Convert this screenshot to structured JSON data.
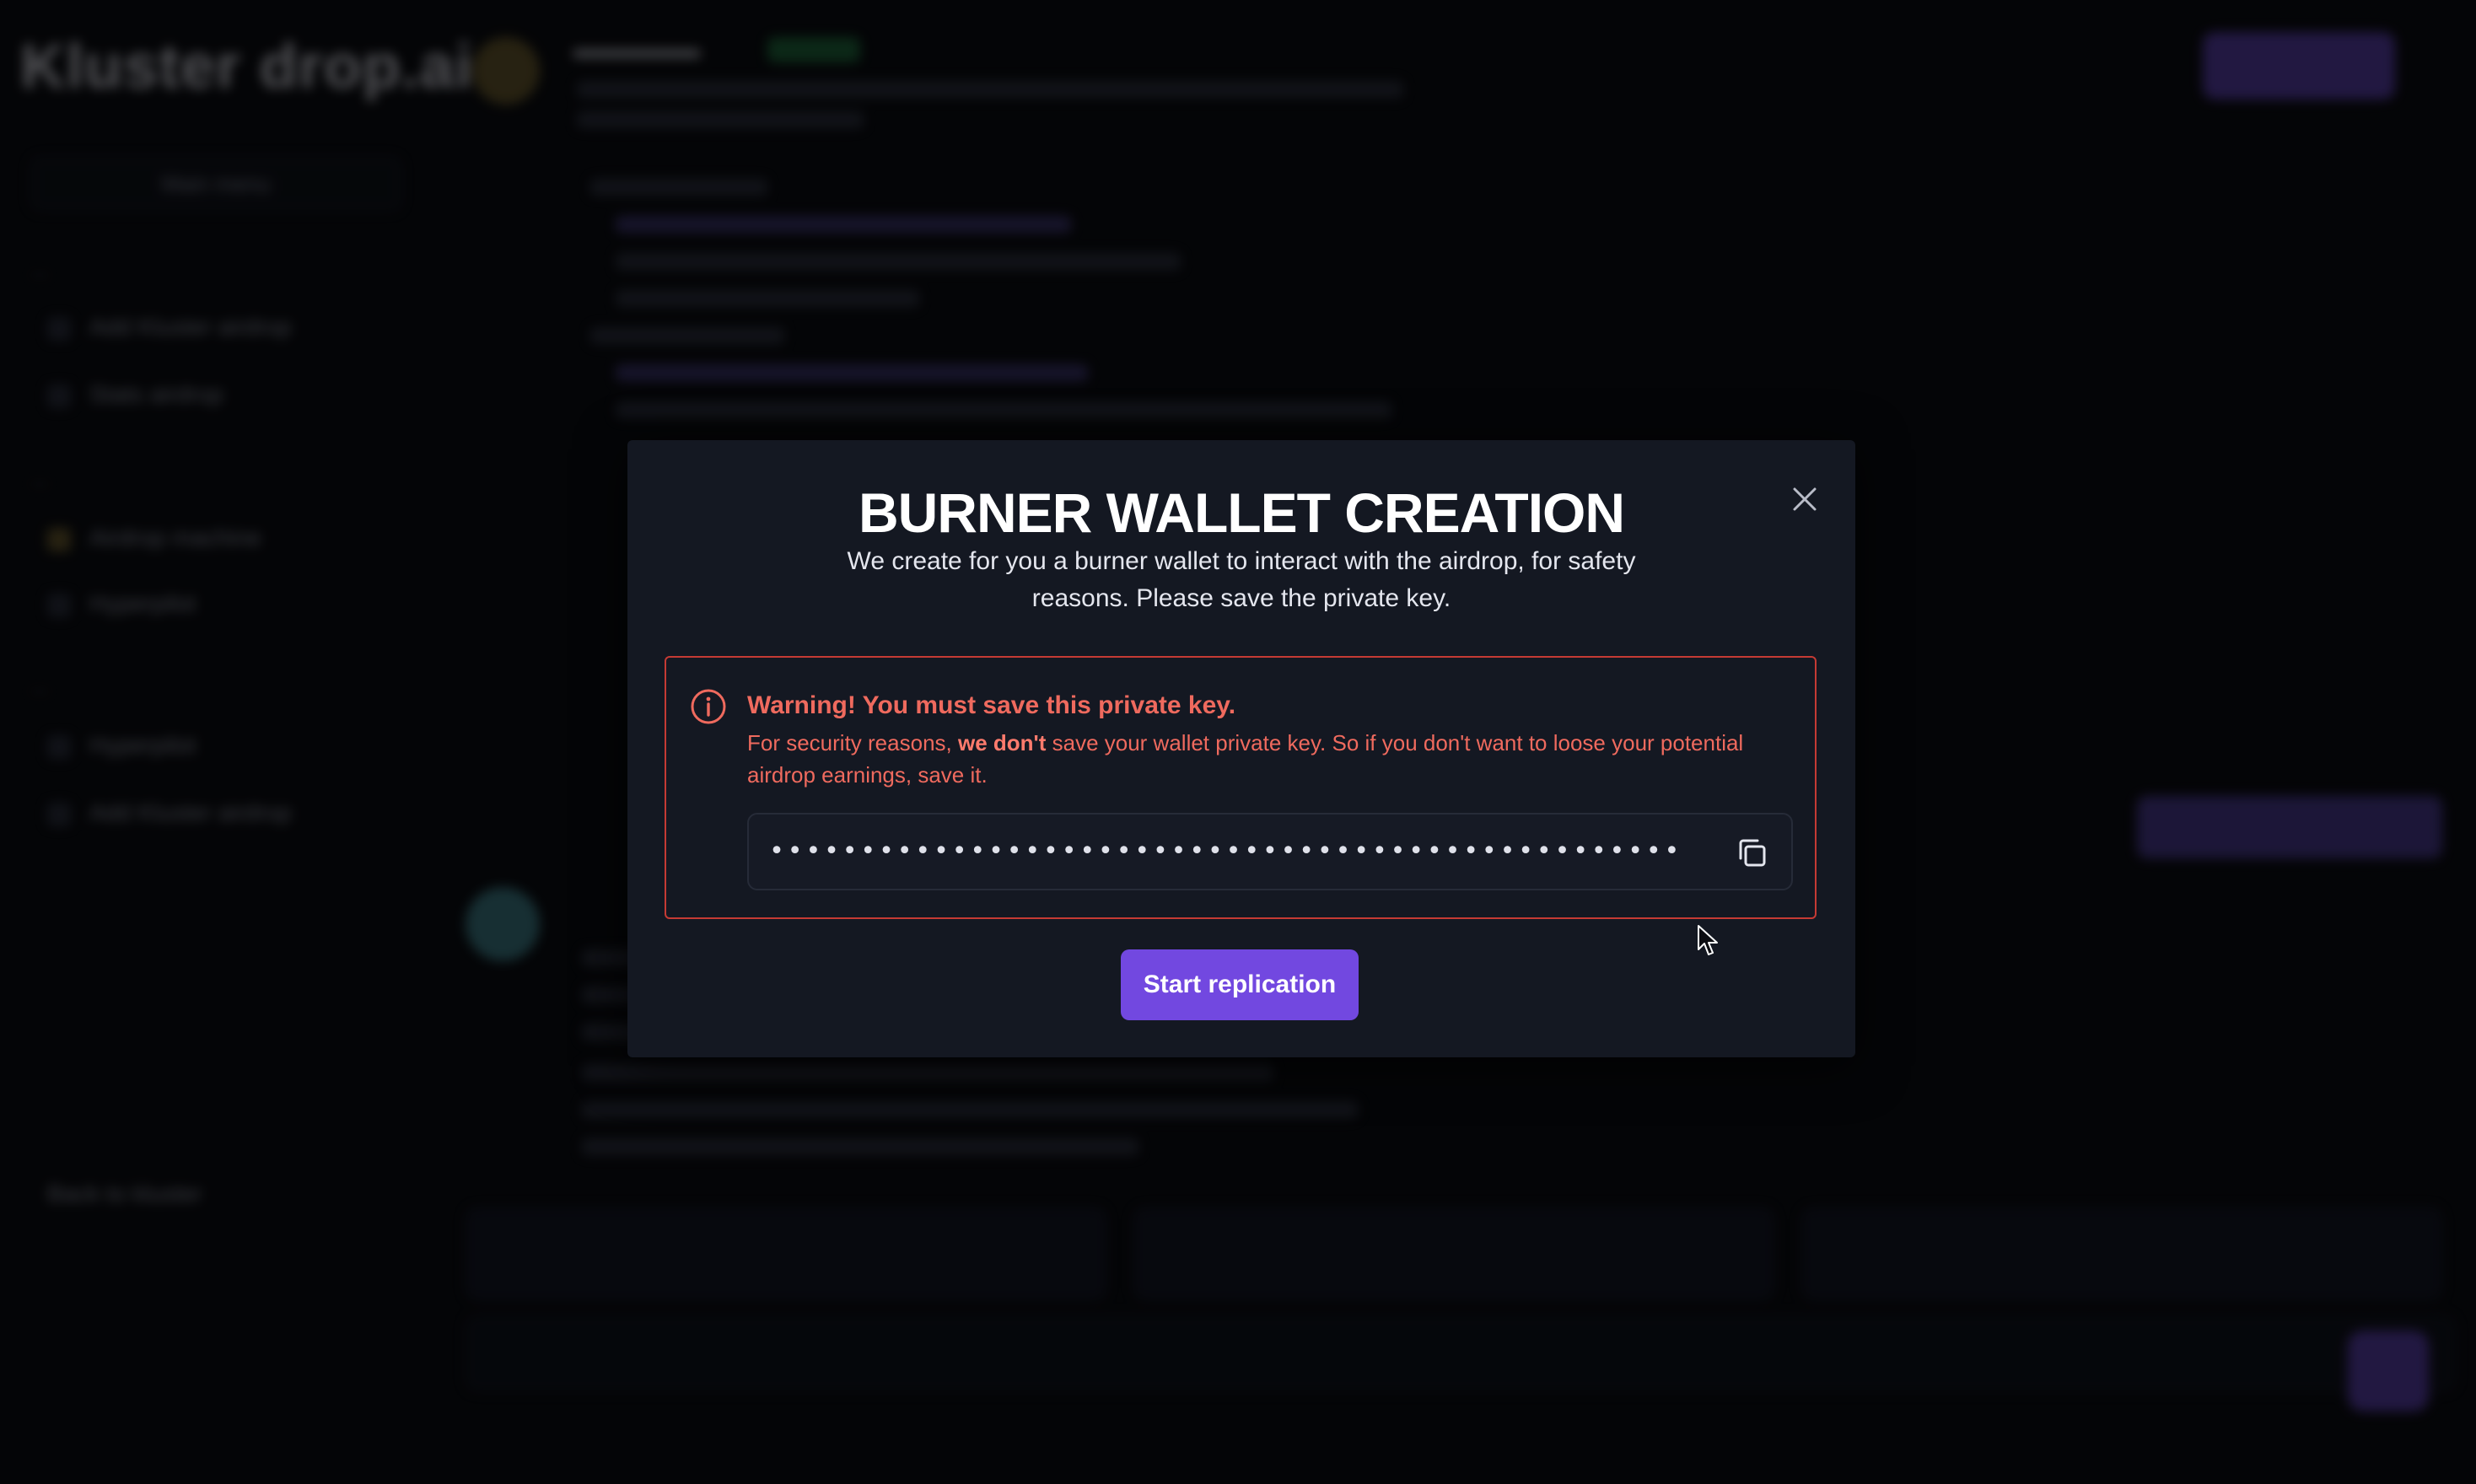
{
  "background": {
    "logo": "Kluster drop.ai",
    "sidebar_select": "Main menu",
    "sidebar_items": [
      "Add Kluster airdrop",
      "Stats airdrop",
      "Airdrop machine",
      "Hyperpilot",
      "Hyperpilot",
      "Add Kluster airdrop"
    ],
    "bottom_link": "Back to kluster"
  },
  "modal": {
    "title": "BURNER WALLET CREATION",
    "subtitle": "We create for you a burner wallet to interact with the airdrop, for safety reasons. Please save the private key.",
    "close_icon": "close-icon"
  },
  "warning": {
    "icon": "info-circle-icon",
    "title": "Warning! You must save this private key.",
    "text_before": "For security reasons, ",
    "text_bold": "we don't",
    "text_after": " save your wallet private key. So if you don't want to loose your potential airdrop earnings, save it.",
    "accent_color": "#ef6a5e"
  },
  "private_key": {
    "masked_value": "••••••••••••••••••••••••••••••••••••••••••••••••••••••••••••••••",
    "copy_icon": "copy-icon"
  },
  "actions": {
    "start_label": "Start replication",
    "start_color": "#7248e0"
  }
}
